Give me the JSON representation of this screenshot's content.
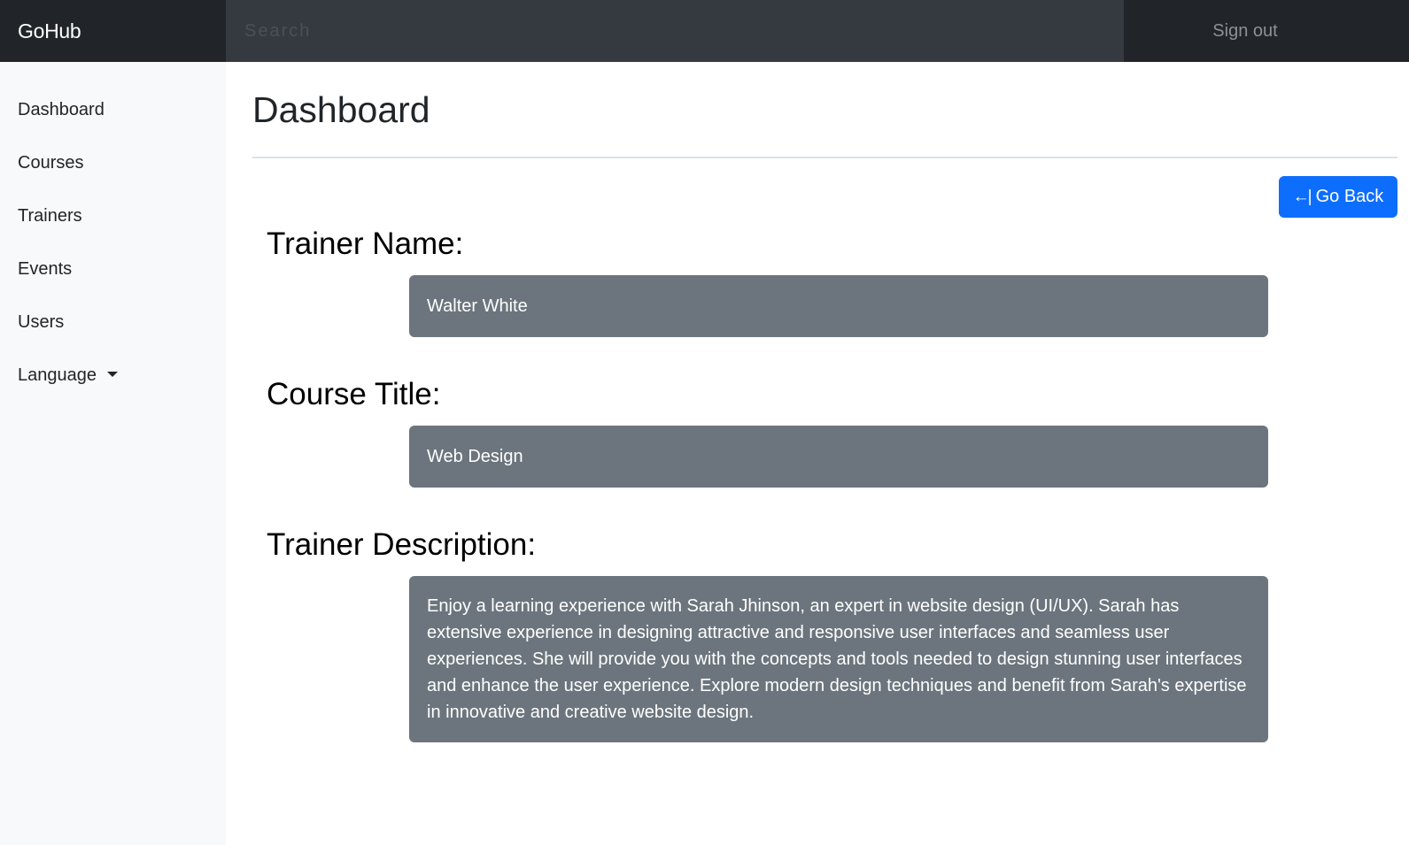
{
  "navbar": {
    "brand": "GoHub",
    "search_placeholder": "Search",
    "signout_label": "Sign out"
  },
  "sidebar": {
    "items": [
      {
        "label": "Dashboard"
      },
      {
        "label": "Courses"
      },
      {
        "label": "Trainers"
      },
      {
        "label": "Events"
      },
      {
        "label": "Users"
      },
      {
        "label": "Language"
      }
    ]
  },
  "main": {
    "title": "Dashboard",
    "back_button": {
      "arrow": "←|",
      "label": "Go Back"
    },
    "fields": [
      {
        "label": "Trainer Name:",
        "value": "Walter White"
      },
      {
        "label": "Course Title:",
        "value": "Web Design"
      },
      {
        "label": "Trainer Description:",
        "value": "Enjoy a learning experience with Sarah Jhinson, an expert in website design (UI/UX). Sarah has extensive experience in designing attractive and responsive user interfaces and seamless user experiences. She will provide you with the concepts and tools needed to design stunning user interfaces and enhance the user experience. Explore modern design techniques and benefit from Sarah's expertise in innovative and creative website design."
      }
    ]
  },
  "colors": {
    "navbar_bg": "#212529",
    "search_bg": "#343a40",
    "sidebar_bg": "#f8f9fa",
    "primary": "#0d6efd",
    "field_bg": "#6c757d"
  }
}
